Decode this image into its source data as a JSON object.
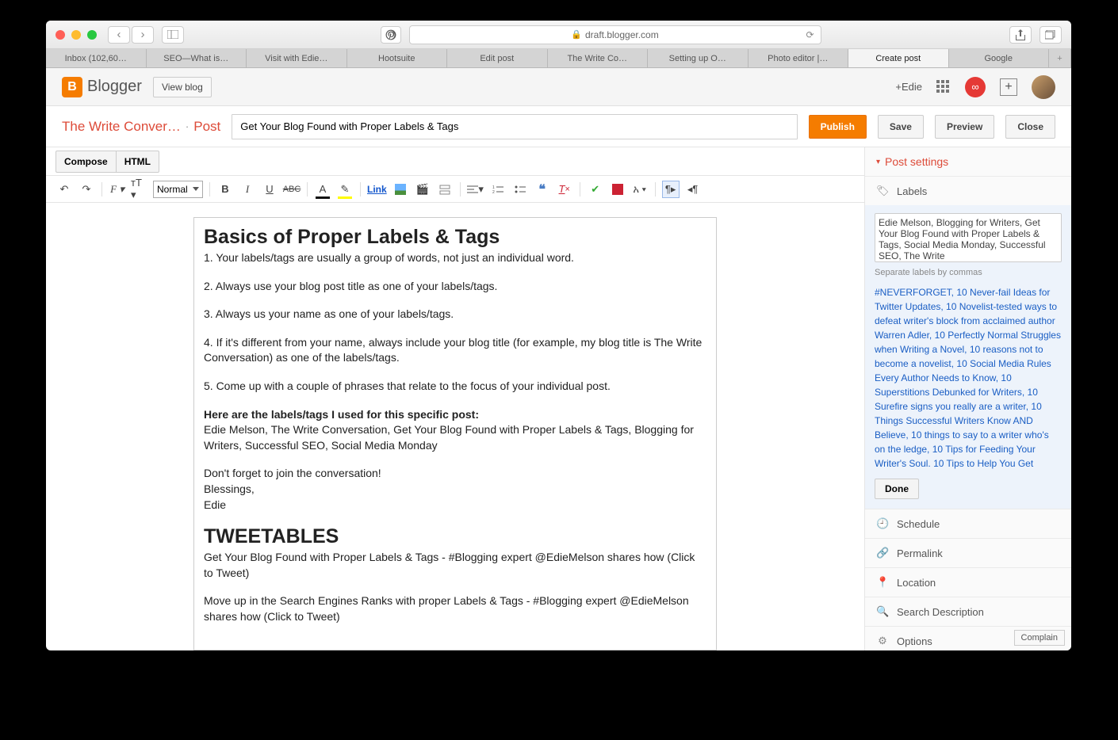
{
  "browser": {
    "url": "draft.blogger.com",
    "tabs": [
      "Inbox (102,60…",
      "SEO—What is…",
      "Visit with Edie…",
      "Hootsuite",
      "Edit post",
      "The Write Co…",
      "Setting up O…",
      "Photo editor |…",
      "Create post",
      "Google"
    ],
    "active_tab_index": 8
  },
  "blogger": {
    "brand": "Blogger",
    "view_blog": "View blog",
    "user_label": "+Edie",
    "blog_title": "The Write Conver…",
    "post_word": "Post",
    "post_title": "Get Your Blog Found with Proper Labels & Tags",
    "buttons": {
      "publish": "Publish",
      "save": "Save",
      "preview": "Preview",
      "close": "Close"
    },
    "mode": {
      "compose": "Compose",
      "html": "HTML"
    },
    "format_select": "Normal",
    "link_label": "Link"
  },
  "post_settings": {
    "title": "Post settings"
  },
  "sections": {
    "labels": "Labels",
    "schedule": "Schedule",
    "permalink": "Permalink",
    "location": "Location",
    "search_desc": "Search Description",
    "options": "Options"
  },
  "labels_panel": {
    "value": "Edie Melson, Blogging for Writers, Get Your Blog Found with Proper Labels & Tags, Social Media Monday, Successful SEO, The Write",
    "hint": "Separate labels by commas",
    "suggestions": "#NEVERFORGET, 10 Never-fail Ideas for Twitter Updates, 10 Novelist-tested ways to defeat writer's block from acclaimed author Warren Adler, 10 Perfectly Normal Struggles when Writing a Novel, 10 reasons not to become a novelist, 10 Social Media Rules Every Author Needs to Know, 10 Superstitions Debunked for Writers, 10 Surefire signs you really are a writer, 10 Things Successful Writers Know AND Believe, 10 things to say to a writer who's on the ledge, 10 Tips for Feeding Your Writer's Soul. 10 Tips to Help You Get",
    "done": "Done"
  },
  "complain": "Complain",
  "content": {
    "h1": "Basics of Proper Labels & Tags",
    "p1": "1. Your labels/tags are usually a group of words, not just an individual word.",
    "p2": "2. Always use your blog post title as one of your labels/tags.",
    "p3": "3. Always us your name as one of your labels/tags.",
    "p4": "4. If it's different from your name, always include your blog title (for example, my blog title is The Write Conversation) as one of the labels/tags.",
    "p5": "5. Come up with a couple of phrases that relate to the focus of your individual post.",
    "b1": "Here are the labels/tags I used for this specific post:",
    "p6": "Edie Melson, The Write Conversation, Get Your Blog Found with Proper Labels & Tags, Blogging for Writers, Successful SEO, Social Media Monday",
    "p7a": "Don't forget to join the conversation!",
    "p7b": "Blessings,",
    "p7c": "Edie",
    "h2": "TWEETABLES",
    "p8": "Get Your Blog Found with Proper Labels & Tags - #Blogging expert @EdieMelson shares how (Click to Tweet)",
    "p9": "Move up in the Search Engines Ranks with proper Labels & Tags - #Blogging expert @EdieMelson shares how (Click to Tweet)"
  }
}
